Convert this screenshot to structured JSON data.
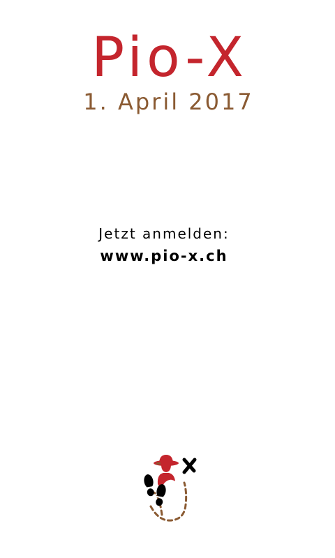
{
  "event": {
    "title": "Pio-X",
    "date": "1. April 2017"
  },
  "signup": {
    "label": "Jetzt anmelden:",
    "url": "www.pio-x.ch"
  },
  "colors": {
    "title": "#c4252d",
    "date": "#8a5a32",
    "text": "#000000",
    "trail": "#8a5a32"
  },
  "logo": {
    "icon": "scout-footprints-treasure-map-icon",
    "mark": "X"
  }
}
